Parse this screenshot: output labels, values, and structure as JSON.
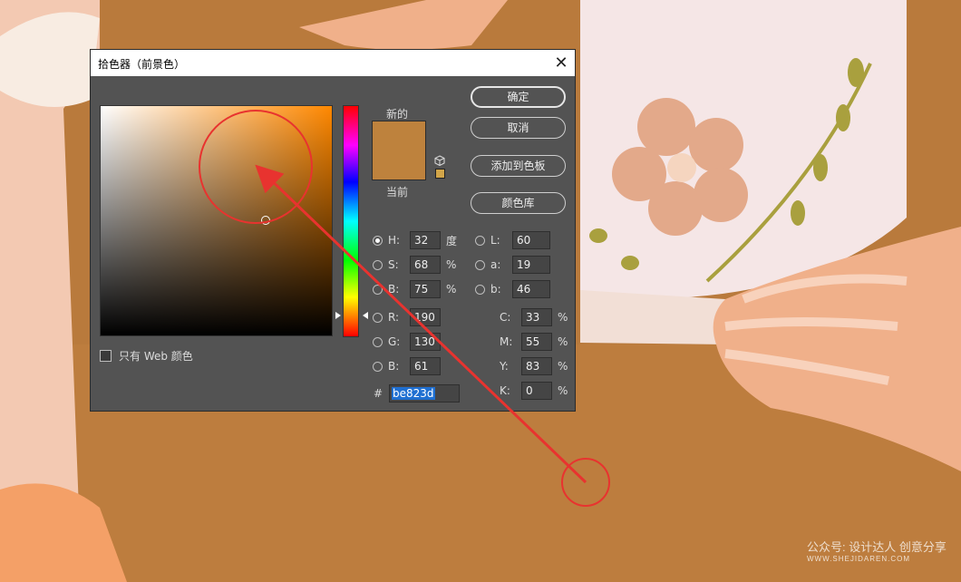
{
  "dialog": {
    "title": "拾色器（前景色）",
    "close_glyph": "✕",
    "label_new": "新的",
    "label_current": "当前",
    "swatch_color": "#be823d",
    "web_only_label": "只有 Web 颜色",
    "buttons": {
      "ok": "确定",
      "cancel": "取消",
      "add_to_swatches": "添加到色板",
      "color_libraries": "颜色库"
    },
    "hsb": {
      "h": {
        "label": "H:",
        "value": "32",
        "unit": "度"
      },
      "s": {
        "label": "S:",
        "value": "68",
        "unit": "%"
      },
      "b": {
        "label": "B:",
        "value": "75",
        "unit": "%"
      }
    },
    "rgb": {
      "r": {
        "label": "R:",
        "value": "190"
      },
      "g": {
        "label": "G:",
        "value": "130"
      },
      "b": {
        "label": "B:",
        "value": "61"
      }
    },
    "lab": {
      "l": {
        "label": "L:",
        "value": "60"
      },
      "a": {
        "label": "a:",
        "value": "19"
      },
      "b": {
        "label": "b:",
        "value": "46"
      }
    },
    "cmyk": {
      "c": {
        "label": "C:",
        "value": "33",
        "unit": "%"
      },
      "m": {
        "label": "M:",
        "value": "55",
        "unit": "%"
      },
      "y": {
        "label": "Y:",
        "value": "83",
        "unit": "%"
      },
      "k": {
        "label": "K:",
        "value": "0",
        "unit": "%"
      }
    },
    "hex": {
      "label": "#",
      "value": "be823d"
    }
  },
  "watermark": {
    "line1": "公众号: 设计达人 创意分享",
    "line2": "WWW.SHEJIDAREN.COM"
  },
  "colors": {
    "annotation_red": "#e8332f",
    "dialog_bg": "#535353"
  }
}
